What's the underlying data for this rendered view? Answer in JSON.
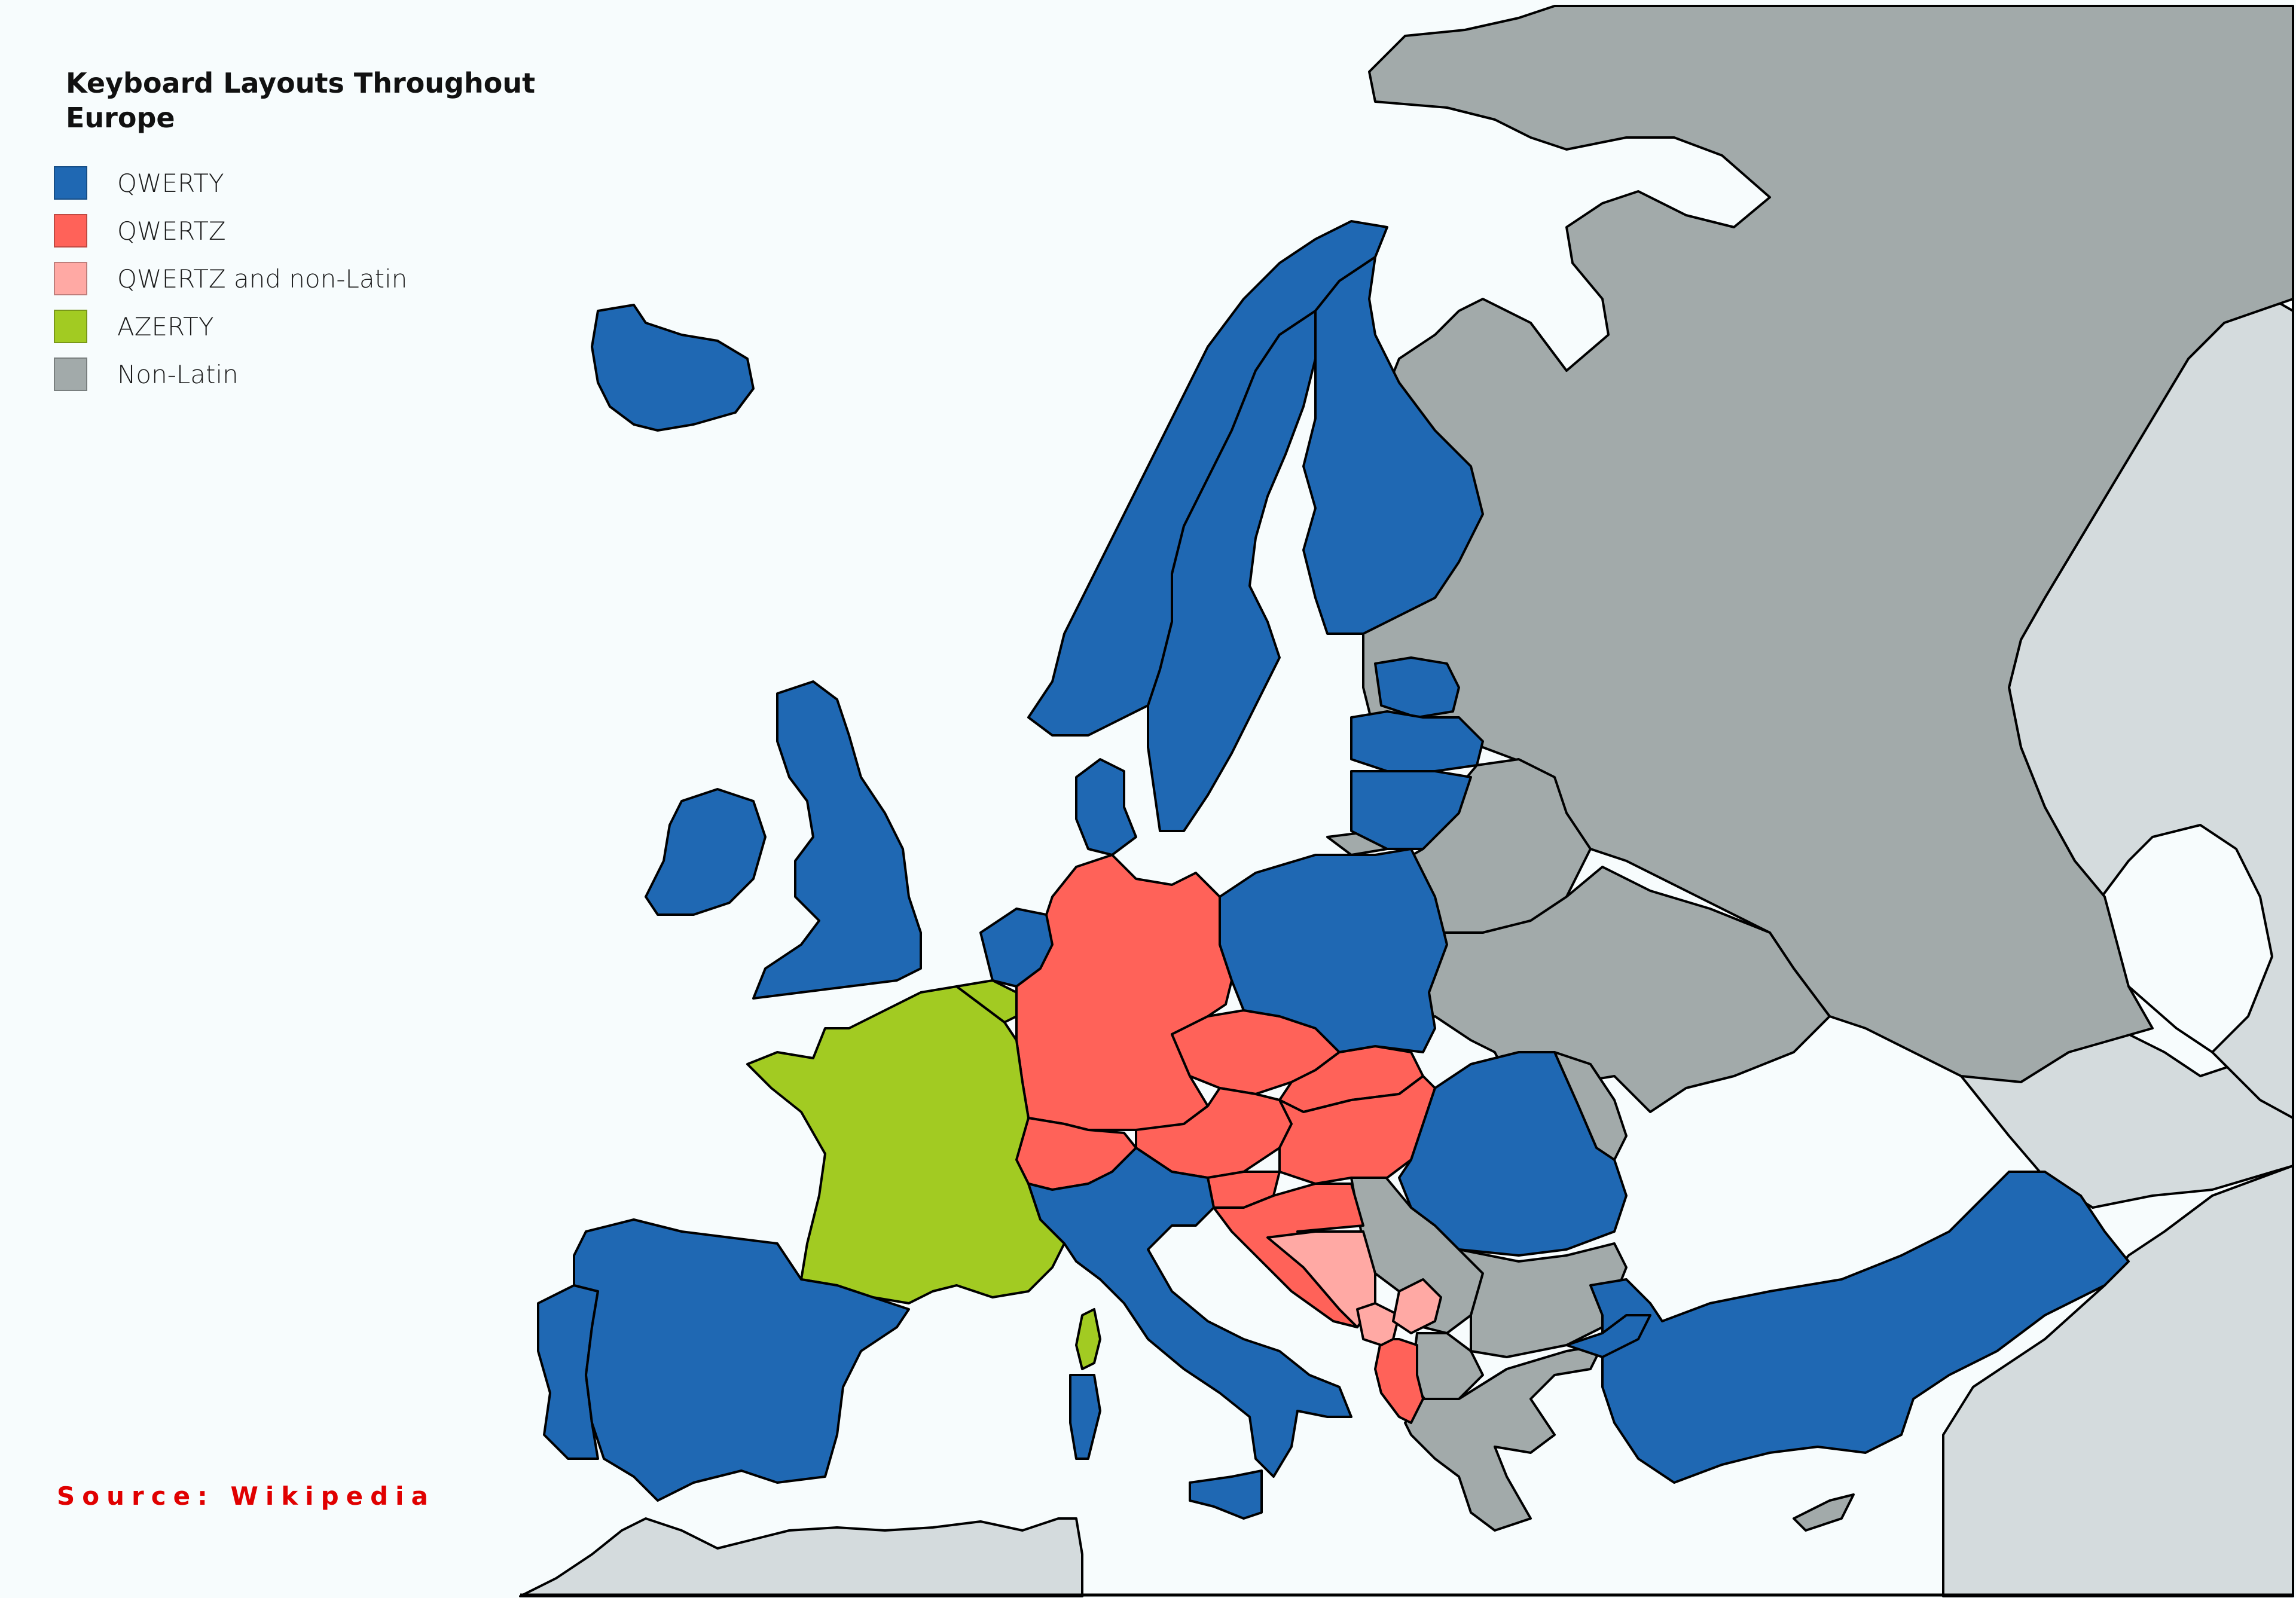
{
  "title": "Keyboard Layouts Throughout Europe",
  "source": "Source: Wikipedia",
  "colors": {
    "background": "#f7fcfd",
    "qwerty": "#1f68b3",
    "qwertz": "#ff6259",
    "qwertz_non_latin": "#ffa9a4",
    "azerty": "#a2cb22",
    "non_latin": "#a2aaaa",
    "outside": "#d4dbdd",
    "source_text": "#e00000"
  },
  "legend": [
    {
      "label": "QWERTY",
      "key": "qwerty"
    },
    {
      "label": "QWERTZ",
      "key": "qwertz"
    },
    {
      "label": "QWERTZ and non-Latin",
      "key": "qwertz_non_latin"
    },
    {
      "label": "AZERTY",
      "key": "azerty"
    },
    {
      "label": "Non-Latin",
      "key": "non_latin"
    }
  ],
  "countries": [
    {
      "name": "Iceland",
      "layout": "qwerty"
    },
    {
      "name": "Ireland",
      "layout": "qwerty"
    },
    {
      "name": "United Kingdom",
      "layout": "qwerty"
    },
    {
      "name": "Norway",
      "layout": "qwerty"
    },
    {
      "name": "Sweden",
      "layout": "qwerty"
    },
    {
      "name": "Finland",
      "layout": "qwerty"
    },
    {
      "name": "Denmark",
      "layout": "qwerty"
    },
    {
      "name": "Estonia",
      "layout": "qwerty"
    },
    {
      "name": "Latvia",
      "layout": "qwerty"
    },
    {
      "name": "Lithuania",
      "layout": "qwerty"
    },
    {
      "name": "Netherlands",
      "layout": "qwerty"
    },
    {
      "name": "Poland",
      "layout": "qwerty"
    },
    {
      "name": "Portugal",
      "layout": "qwerty"
    },
    {
      "name": "Spain",
      "layout": "qwerty"
    },
    {
      "name": "Italy",
      "layout": "qwerty"
    },
    {
      "name": "Romania",
      "layout": "qwerty"
    },
    {
      "name": "Turkey",
      "layout": "qwerty"
    },
    {
      "name": "Germany",
      "layout": "qwertz"
    },
    {
      "name": "Switzerland",
      "layout": "qwertz"
    },
    {
      "name": "Austria",
      "layout": "qwertz"
    },
    {
      "name": "Czechia",
      "layout": "qwertz"
    },
    {
      "name": "Slovakia",
      "layout": "qwertz"
    },
    {
      "name": "Hungary",
      "layout": "qwertz"
    },
    {
      "name": "Slovenia",
      "layout": "qwertz"
    },
    {
      "name": "Croatia",
      "layout": "qwertz"
    },
    {
      "name": "Albania",
      "layout": "qwertz"
    },
    {
      "name": "Bosnia and Herzegovina",
      "layout": "qwertz_non_latin"
    },
    {
      "name": "Montenegro",
      "layout": "qwertz_non_latin"
    },
    {
      "name": "Kosovo",
      "layout": "qwertz_non_latin"
    },
    {
      "name": "France",
      "layout": "azerty"
    },
    {
      "name": "Belgium",
      "layout": "azerty"
    },
    {
      "name": "Corsica",
      "layout": "azerty"
    },
    {
      "name": "Russia",
      "layout": "non_latin"
    },
    {
      "name": "Belarus",
      "layout": "non_latin"
    },
    {
      "name": "Ukraine",
      "layout": "non_latin"
    },
    {
      "name": "Moldova",
      "layout": "non_latin"
    },
    {
      "name": "Serbia",
      "layout": "non_latin"
    },
    {
      "name": "Bulgaria",
      "layout": "non_latin"
    },
    {
      "name": "North Macedonia",
      "layout": "non_latin"
    },
    {
      "name": "Greece",
      "layout": "non_latin"
    },
    {
      "name": "Cyprus",
      "layout": "non_latin"
    },
    {
      "name": "Kaliningrad",
      "layout": "non_latin"
    }
  ]
}
